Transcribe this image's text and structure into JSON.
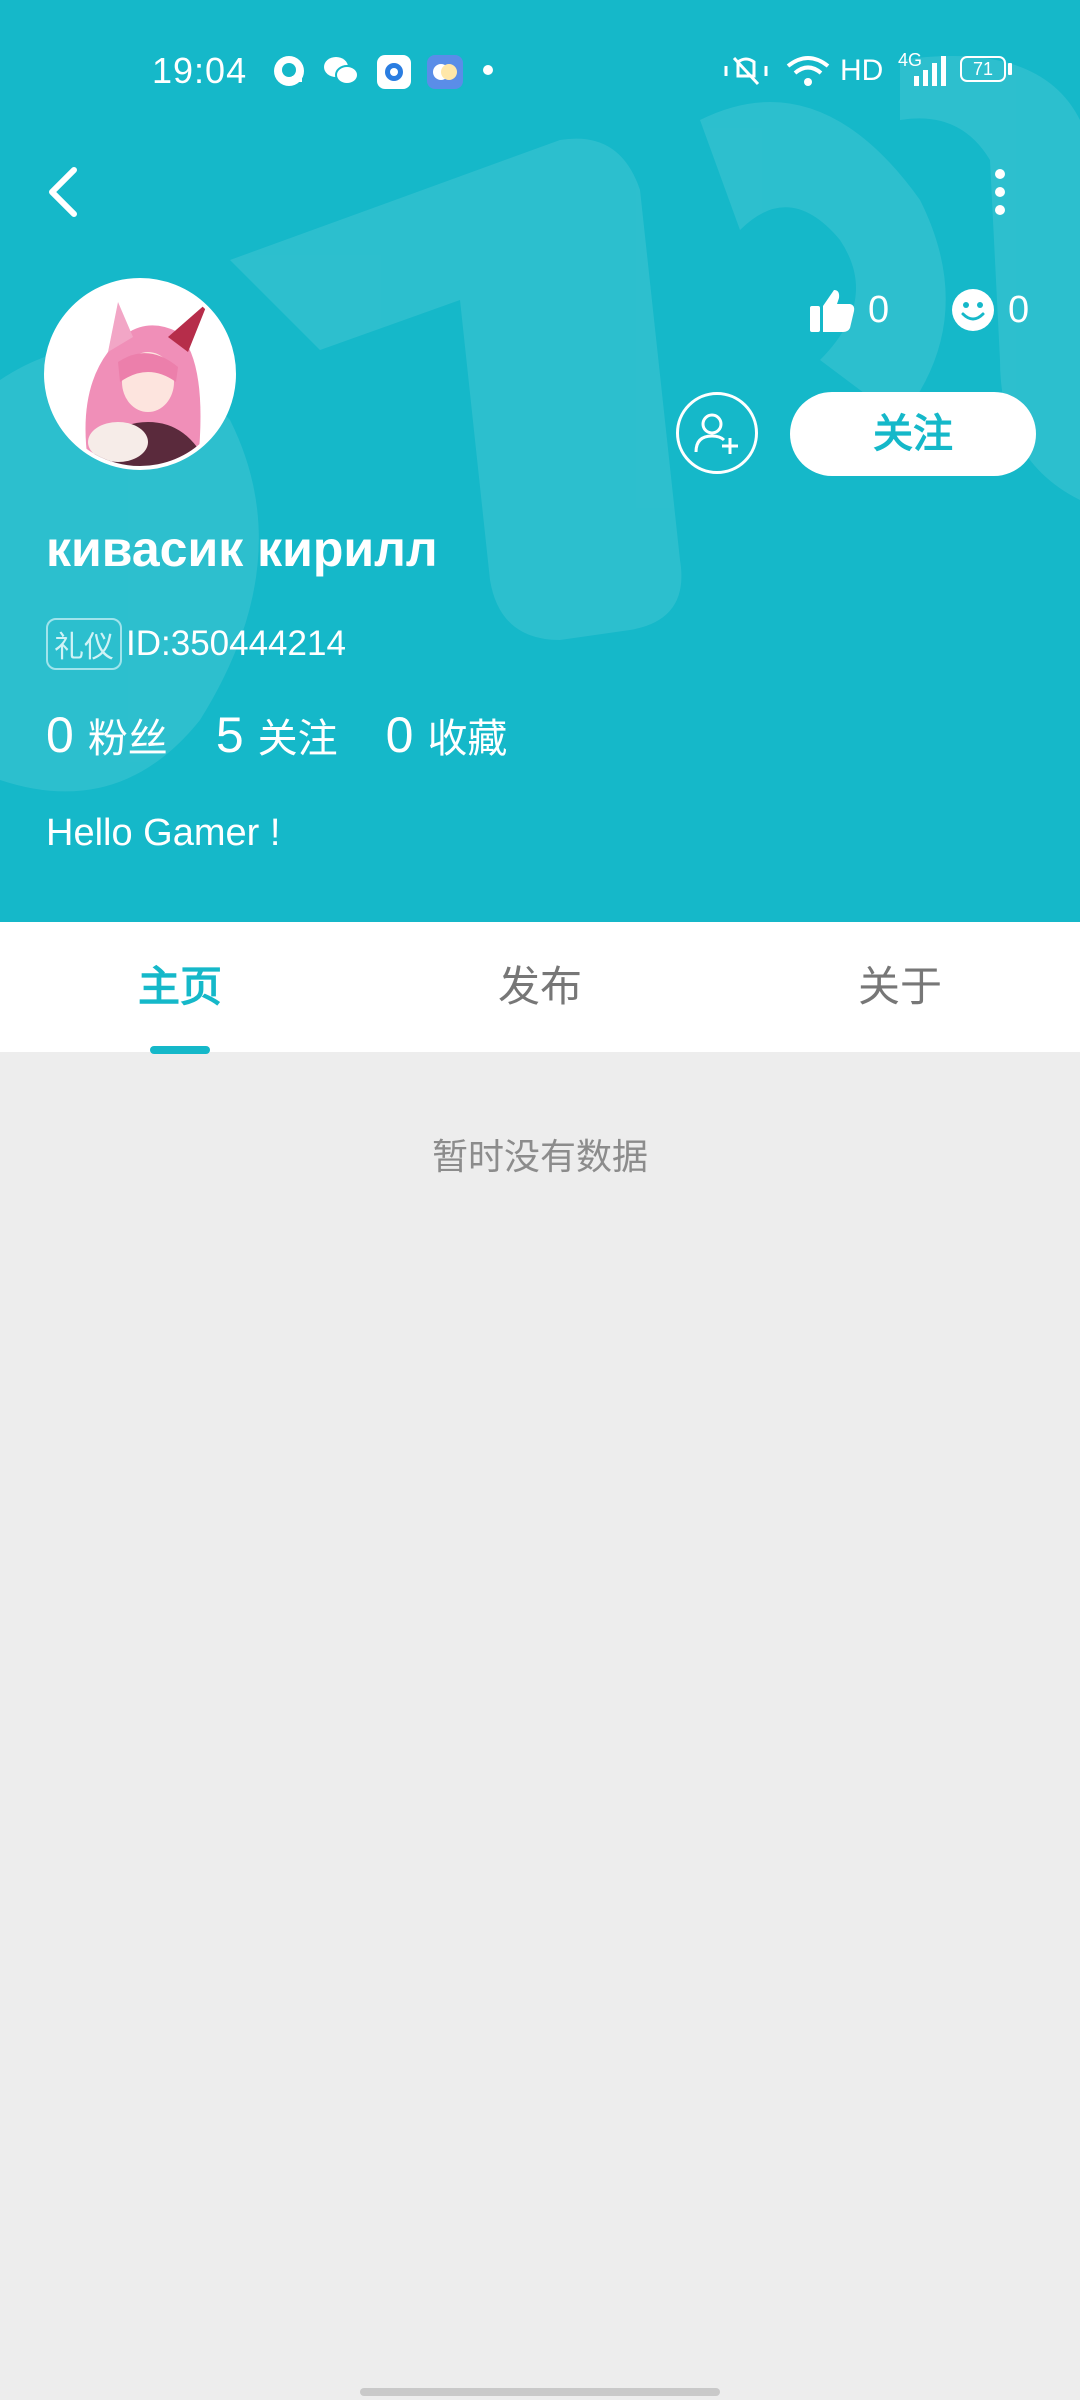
{
  "status_bar": {
    "time": "19:04",
    "left_icons": [
      "qq-icon",
      "wechat-icon",
      "app-icon",
      "weather-icon",
      "dot-icon"
    ],
    "right_icons": [
      "vibrate-icon",
      "wifi-icon",
      "signal-icon"
    ],
    "hd_label": "HD",
    "network_label": "4G",
    "battery": "71"
  },
  "header": {
    "back_icon": "back-arrow-icon",
    "more_icon": "more-vertical-icon",
    "likes_count": "0",
    "emoji_count": "0",
    "follow_label": "关注",
    "add_friend_icon": "add-user-icon"
  },
  "profile": {
    "username": "кивасик кирилл",
    "badge": "礼仪",
    "id_text": "ID:350444214",
    "fans_count": "0",
    "fans_label": "粉丝",
    "following_count": "5",
    "following_label": "关注",
    "favorites_count": "0",
    "favorites_label": "收藏",
    "bio": "Hello Gamer !"
  },
  "tabs": [
    {
      "label": "主页",
      "active": true
    },
    {
      "label": "发布",
      "active": false
    },
    {
      "label": "关于",
      "active": false
    }
  ],
  "content": {
    "empty_text": "暂时没有数据"
  },
  "colors": {
    "accent": "#15b8c9",
    "background": "#ededed",
    "white": "#ffffff"
  }
}
